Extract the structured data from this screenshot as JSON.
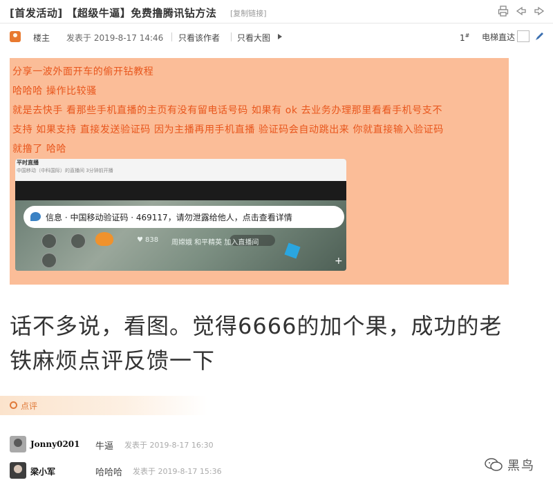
{
  "title_bar": {
    "title": "[首发活动] 【超级牛逼】免费撸腾讯钻方法",
    "copy_link": "[复制链接]"
  },
  "author_bar": {
    "role": "楼主",
    "posted_at": "发表于 2019-8-17 14:46",
    "only_author": "只看该作者",
    "only_big_image": "只看大图",
    "floor": "1",
    "elevator": "电梯直达"
  },
  "post": {
    "highlight_lines": [
      "分享一波外面开车的偷开钻教程",
      "哈哈哈  操作比较骚",
      "就是去快手 看那些手机直播的主页有没有留电话号码 如果有  ok 去业务办理那里看看手机号支不",
      "支持 如果支持 直接发送验证码 因为主播再用手机直播 验证码会自动跳出来  你就直接输入验证码",
      "就撸了  哈哈"
    ],
    "screenshot": {
      "top_title": "平时直播",
      "top_sub": "中国移动（中科国际）的直播间  3分钟前开播",
      "notification": "信息 · 中国移动验证码 · 469117，请勿泄露给他人，点击查看详情",
      "like_count": "838",
      "live_text": "周嫦娥  和平精英 加入直播间"
    },
    "big_lines": [
      "话不多说，看图。觉得6666的加个果，成功的老",
      "铁麻烦点评反馈一下"
    ]
  },
  "comments_header": "点评",
  "comments": [
    {
      "user": "Jonny0201",
      "message": "牛逼",
      "time": "发表于 2019-8-17 16:30"
    },
    {
      "user": "梁小军",
      "message": "哈哈哈",
      "time": "发表于 2019-8-17 15:36"
    }
  ],
  "watermark": "黑鸟",
  "colors": {
    "highlight_bg": "#fbbd98",
    "highlight_text": "#e8561c",
    "comment_accent": "#e07a3a"
  }
}
